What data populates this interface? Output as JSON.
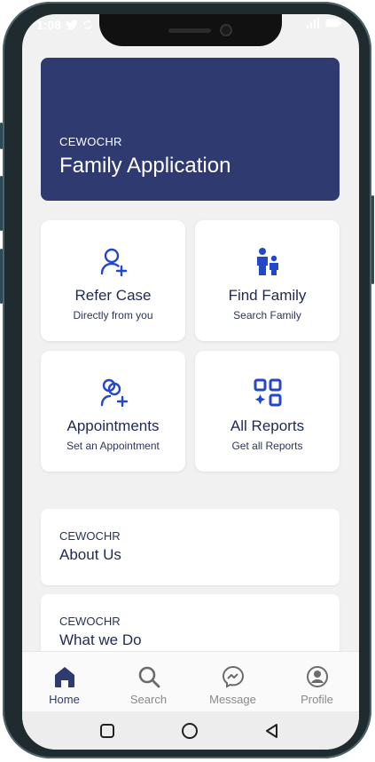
{
  "status_bar": {
    "time": "1:08"
  },
  "header": {
    "org": "CEWOCHR",
    "title": "Family Application"
  },
  "tiles": [
    {
      "title": "Refer Case",
      "subtitle": "Directly from you",
      "icon": "add-user-icon"
    },
    {
      "title": "Find Family",
      "subtitle": "Search Family",
      "icon": "family-icon"
    },
    {
      "title": "Appointments",
      "subtitle": "Set an Appointment",
      "icon": "add-group-icon"
    },
    {
      "title": "All Reports",
      "subtitle": "Get all Reports",
      "icon": "dashboard-grid-icon"
    }
  ],
  "info_cards": [
    {
      "org": "CEWOCHR",
      "label": "About Us"
    },
    {
      "org": "CEWOCHR",
      "label": "What we Do"
    }
  ],
  "bottom_nav": [
    {
      "label": "Home",
      "icon": "home-icon",
      "active": true
    },
    {
      "label": "Search",
      "icon": "search-icon",
      "active": false
    },
    {
      "label": "Message",
      "icon": "messenger-icon",
      "active": false
    },
    {
      "label": "Profile",
      "icon": "profile-icon",
      "active": false
    }
  ],
  "colors": {
    "primary": "#2e3a70",
    "icon_blue": "#2447c9",
    "background": "#f1f1f1",
    "inactive": "#8a8a8a"
  }
}
